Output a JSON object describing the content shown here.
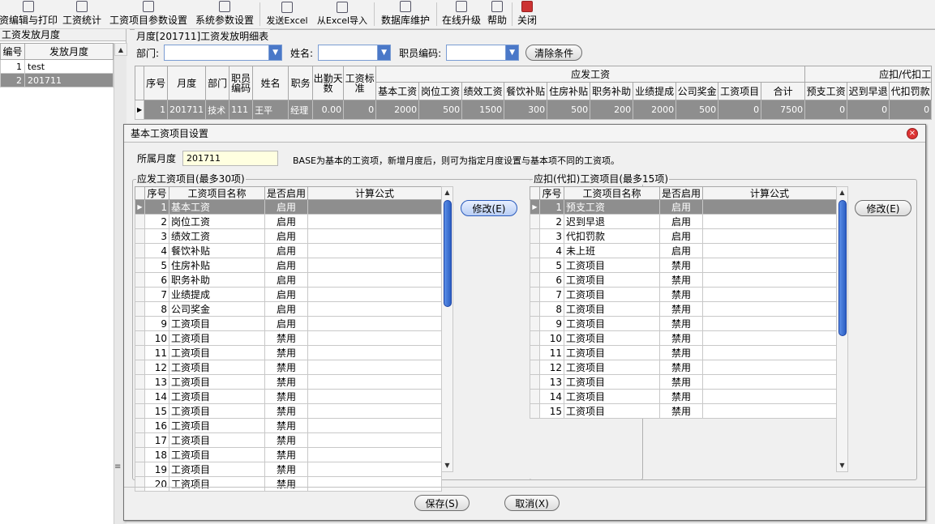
{
  "toolbar": {
    "items": [
      {
        "label": "资编辑与打印",
        "icon": "print-icon"
      },
      {
        "label": "工资统计",
        "icon": "stats-icon"
      },
      {
        "label": "工资项目参数设置",
        "icon": "params-icon"
      },
      {
        "label": "系统参数设置",
        "icon": "grid-settings-icon"
      },
      {
        "label": "发送Excel",
        "icon": "excel-send-icon"
      },
      {
        "label": "从Excel导入",
        "icon": "excel-import-icon"
      },
      {
        "label": "数据库维护",
        "icon": "database-icon"
      },
      {
        "label": "在线升级",
        "icon": "upgrade-icon"
      },
      {
        "label": "帮助",
        "icon": "help-icon"
      },
      {
        "label": "关闭",
        "icon": "close-door-icon"
      }
    ]
  },
  "left_panel": {
    "title": "工资发放月度",
    "headers": [
      "编号",
      "发放月度"
    ],
    "rows": [
      {
        "id": "1",
        "month": "test"
      },
      {
        "id": "2",
        "month": "201711"
      }
    ]
  },
  "detail": {
    "title": "月度[201711]工资发放明细表",
    "filters": {
      "dept_label": "部门:",
      "dept_value": "",
      "name_label": "姓名:",
      "name_value": "",
      "code_label": "职员编码:",
      "code_value": "",
      "clear_label": "清除条件"
    },
    "group_headers": {
      "payable": "应发工资",
      "deduct": "应扣/代扣工"
    },
    "columns": [
      "序号",
      "月度",
      "部门",
      "职员编码",
      "姓名",
      "职务",
      "出勤天数",
      "工资标准",
      "基本工资",
      "岗位工资",
      "绩效工资",
      "餐饮补贴",
      "住房补贴",
      "职务补助",
      "业绩提成",
      "公司奖金",
      "工资项目",
      "合计",
      "预支工资",
      "迟到早退",
      "代扣罚款"
    ],
    "rows": [
      [
        "1",
        "201711",
        "技术",
        "111",
        "王平",
        "经理",
        "0.00",
        "0",
        "2000",
        "500",
        "1500",
        "300",
        "500",
        "200",
        "2000",
        "500",
        "0",
        "7500",
        "0",
        "0",
        "0"
      ]
    ]
  },
  "dialog": {
    "title": "基本工资项目设置",
    "month_label": "所属月度",
    "month_value": "201711",
    "hint": "BASE为基本的工资项，新增月度后，则可为指定月度设置与基本项不同的工资项。",
    "payable": {
      "title": "应发工资项目(最多30项)",
      "headers": [
        "序号",
        "工资项目名称",
        "是否启用",
        "计算公式"
      ],
      "rows": [
        [
          "1",
          "基本工资",
          "启用",
          ""
        ],
        [
          "2",
          "岗位工资",
          "启用",
          ""
        ],
        [
          "3",
          "绩效工资",
          "启用",
          ""
        ],
        [
          "4",
          "餐饮补贴",
          "启用",
          ""
        ],
        [
          "5",
          "住房补贴",
          "启用",
          ""
        ],
        [
          "6",
          "职务补助",
          "启用",
          ""
        ],
        [
          "7",
          "业绩提成",
          "启用",
          ""
        ],
        [
          "8",
          "公司奖金",
          "启用",
          ""
        ],
        [
          "9",
          "工资项目",
          "启用",
          ""
        ],
        [
          "10",
          "工资项目",
          "禁用",
          ""
        ],
        [
          "11",
          "工资项目",
          "禁用",
          ""
        ],
        [
          "12",
          "工资项目",
          "禁用",
          ""
        ],
        [
          "13",
          "工资项目",
          "禁用",
          ""
        ],
        [
          "14",
          "工资项目",
          "禁用",
          ""
        ],
        [
          "15",
          "工资项目",
          "禁用",
          ""
        ],
        [
          "16",
          "工资项目",
          "禁用",
          ""
        ],
        [
          "17",
          "工资项目",
          "禁用",
          ""
        ],
        [
          "18",
          "工资项目",
          "禁用",
          ""
        ],
        [
          "19",
          "工资项目",
          "禁用",
          ""
        ],
        [
          "20",
          "工资项目",
          "禁用",
          ""
        ]
      ],
      "modify_label": "修改(E)"
    },
    "deduct": {
      "title": "应扣(代扣)工资项目(最多15项)",
      "headers": [
        "序号",
        "工资项目名称",
        "是否启用",
        "计算公式"
      ],
      "rows": [
        [
          "1",
          "预支工资",
          "启用",
          ""
        ],
        [
          "2",
          "迟到早退",
          "启用",
          ""
        ],
        [
          "3",
          "代扣罚款",
          "启用",
          ""
        ],
        [
          "4",
          "未上班",
          "启用",
          ""
        ],
        [
          "5",
          "工资项目",
          "禁用",
          ""
        ],
        [
          "6",
          "工资项目",
          "禁用",
          ""
        ],
        [
          "7",
          "工资项目",
          "禁用",
          ""
        ],
        [
          "8",
          "工资项目",
          "禁用",
          ""
        ],
        [
          "9",
          "工资项目",
          "禁用",
          ""
        ],
        [
          "10",
          "工资项目",
          "禁用",
          ""
        ],
        [
          "11",
          "工资项目",
          "禁用",
          ""
        ],
        [
          "12",
          "工资项目",
          "禁用",
          ""
        ],
        [
          "13",
          "工资项目",
          "禁用",
          ""
        ],
        [
          "14",
          "工资项目",
          "禁用",
          ""
        ],
        [
          "15",
          "工资项目",
          "禁用",
          ""
        ]
      ],
      "modify_label": "修改(E)"
    },
    "save_label": "保存(S)",
    "cancel_label": "取消(X)"
  }
}
